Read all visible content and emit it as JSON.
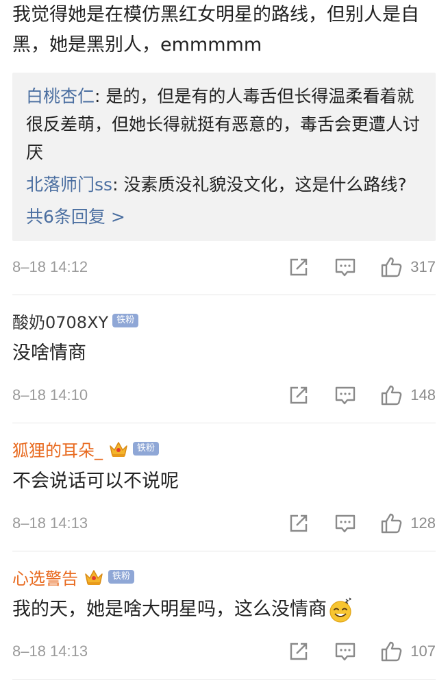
{
  "top_comment": {
    "text": "我觉得她是在模仿黑红女明星的路线，但别人是自黑，她是黑别人，emmmmm",
    "replies": [
      {
        "user": "白桃杏仁",
        "text": ": 是的，但是有的人毒舌但长得温柔看着就很反差萌，但她长得就挺有恶意的，毒舌会更遭人讨厌"
      },
      {
        "user": "北落师门ss",
        "text": ": 没素质没礼貌没文化，这是什么路线?"
      }
    ],
    "more_replies": "共6条回复 >",
    "time": "8–18 14:12",
    "likes": "317"
  },
  "comments": [
    {
      "user": "酸奶0708XY",
      "badge": "铁粉",
      "text": "没啥情商",
      "time": "8–18 14:10",
      "likes": "148",
      "username_color": "#333333"
    },
    {
      "user": "狐狸的耳朵_",
      "badge": "铁粉",
      "text": "不会说话可以不说呢",
      "time": "8–18 14:13",
      "likes": "128",
      "username_color": "#e86a1f"
    },
    {
      "user": "心选警告",
      "badge": "铁粉",
      "text": "我的天，她是啥大明星吗，这么没情商",
      "time": "8–18 14:13",
      "likes": "107",
      "username_color": "#e86a1f"
    }
  ],
  "icons": {
    "share": "share-icon",
    "comment": "comment-icon",
    "like": "thumbs-up-icon",
    "crown": "crown-icon",
    "emoji": "sweating-smile-emoji-icon"
  },
  "colors": {
    "link_blue": "#4a6ea0",
    "vip_orange": "#e86a1f",
    "meta_gray": "#9a9a9a",
    "reply_bg": "#f2f2f2",
    "badge_blue": "#8fa7d6"
  }
}
